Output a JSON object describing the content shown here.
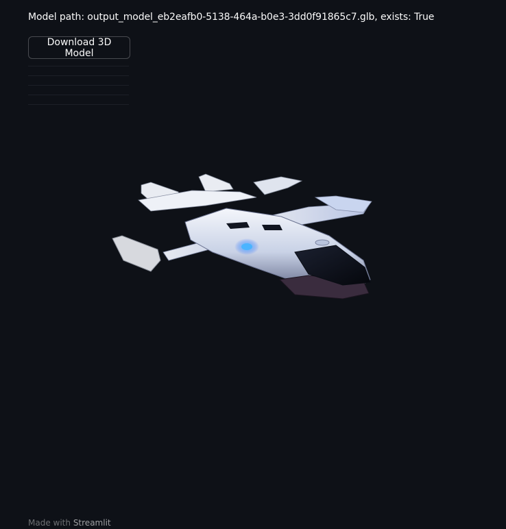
{
  "status": {
    "model_path_text": "Model path: output_model_eb2eafb0-5138-464a-b0e3-3dd0f91865c7.glb, exists: True"
  },
  "actions": {
    "download_label": "Download 3D Model"
  },
  "viewer": {
    "subject": "vtol-aircraft-3d-model",
    "accent_color": "#3aa0ff",
    "body_color": "#e8ecf4"
  },
  "footer": {
    "made_with": "Made with",
    "brand": "Streamlit"
  },
  "theme": {
    "background": "#0e1117",
    "text": "#fafafa"
  }
}
